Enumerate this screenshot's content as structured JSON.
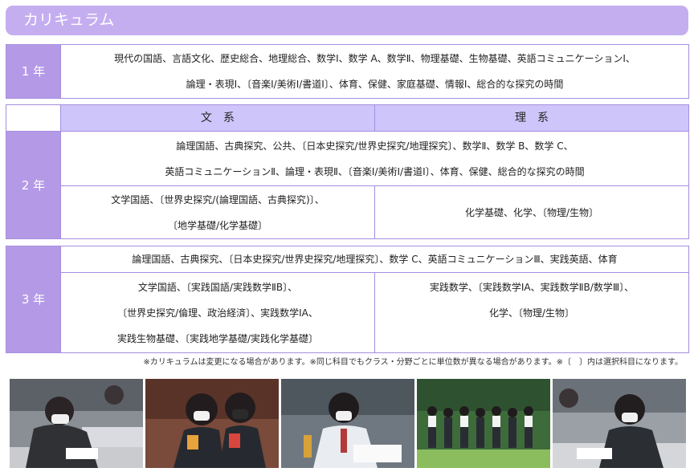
{
  "header": {
    "title": "カリキュラム"
  },
  "grade1": {
    "label": "1 年",
    "line1": "現代の国語、言語文化、歴史総合、地理総合、数学Ⅰ、数学 A、数学Ⅱ、物理基礎、生物基礎、英語コミュニケーションⅠ、",
    "line2": "論理・表現Ⅰ、〔音楽Ⅰ/美術Ⅰ/書道Ⅰ〕、体育、保健、家庭基礎、情報Ⅰ、総合的な探究の時間"
  },
  "columns": {
    "bunkei": "文　系",
    "rikei": "理　系"
  },
  "grade2": {
    "label": "2 年",
    "common_line1": "論理国語、古典探究、公共、〔日本史探究/世界史探究/地理探究〕、数学Ⅱ、数学 B、数学 C、",
    "common_line2": "英語コミュニケーションⅡ、論理・表現Ⅱ、〔音楽Ⅰ/美術Ⅰ/書道Ⅰ〕、体育、保健、総合的な探究の時間",
    "bunkei_line1": "文学国語、〔世界史探究/(論理国語、古典探究)〕、",
    "bunkei_line2": "〔地学基礎/化学基礎〕",
    "rikei_line1": "化学基礎、化学、〔物理/生物〕"
  },
  "grade3": {
    "label": "3 年",
    "common_line1": "論理国語、古典探究、〔日本史探究/世界史探究/地理探究〕、数学 C、英語コミュニケーションⅢ、実践英語、体育",
    "bunkei_line1": "文学国語、〔実践国語/実践数学ⅡB〕、",
    "bunkei_line2": "〔世界史探究/倫理、政治経済〕、実践数学ⅠA、",
    "bunkei_line3": "実践生物基礎、〔実践地学基礎/実践化学基礎〕",
    "rikei_line1": "実践数学、〔実践数学ⅠA、実践数学ⅡB/数学Ⅲ〕、",
    "rikei_line2": "化学、〔物理/生物〕"
  },
  "footnote": "※カリキュラムは変更になる場合があります。※同じ科目でもクラス・分野ごとに単位数が異なる場合があります。※〔　〕内は選択科目になります。",
  "colors": {
    "header_bg": "#c4aef0",
    "year_bg": "#b49ae6",
    "column_head_bg": "#cec6fa",
    "border": "#a58ee0"
  },
  "photos": [
    {
      "description": "student-writing-at-desk"
    },
    {
      "description": "two-students-holding-items"
    },
    {
      "description": "student-studying-with-textbook"
    },
    {
      "description": "students-group-outdoors"
    },
    {
      "description": "student-writing-in-classroom"
    }
  ]
}
